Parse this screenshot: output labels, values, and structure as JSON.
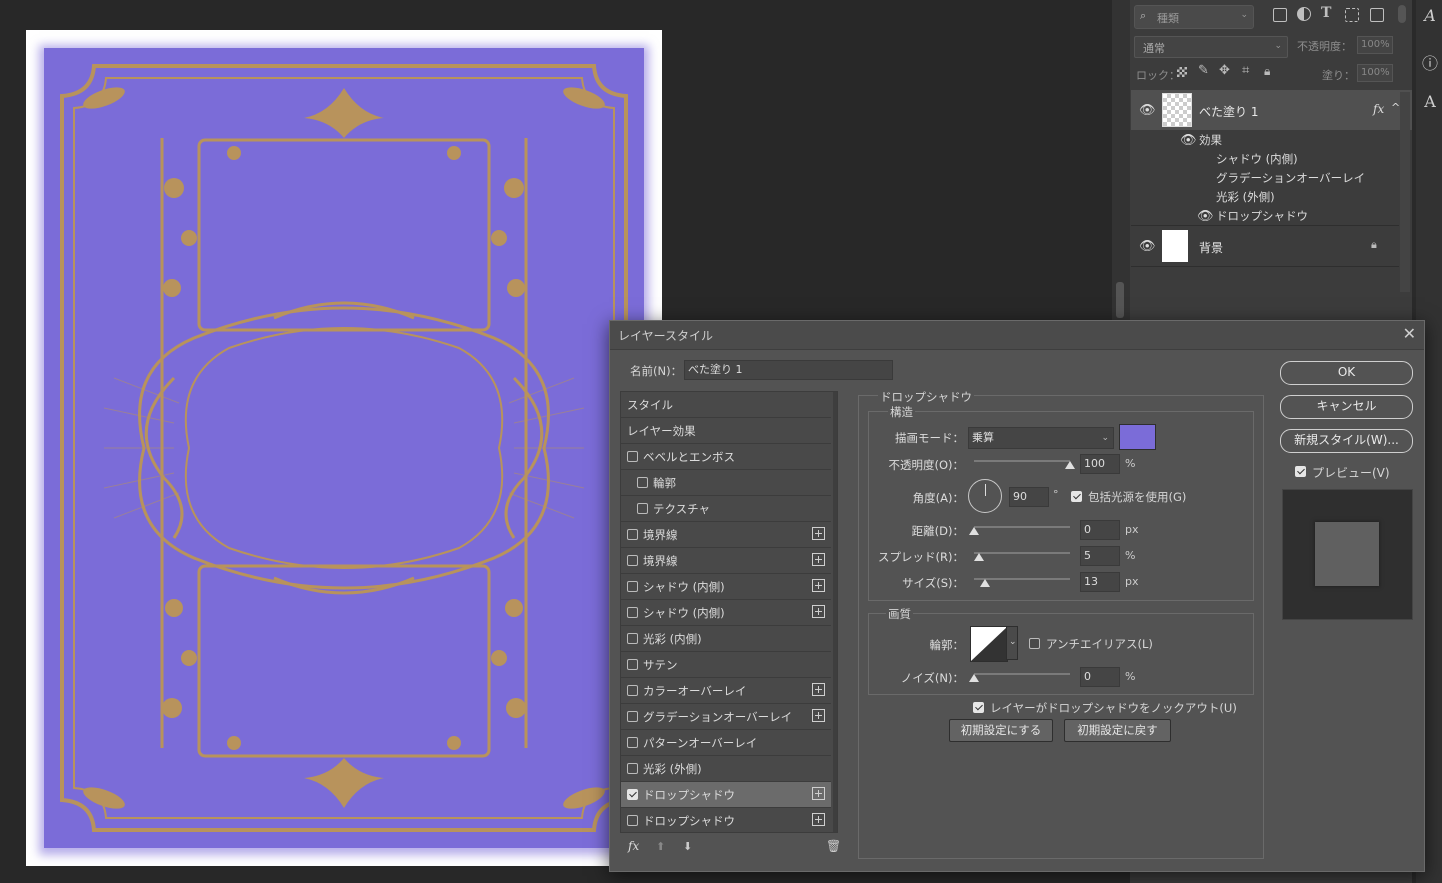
{
  "layers_panel": {
    "filter_placeholder": "種類",
    "blend_mode": "通常",
    "opacity_label": "不透明度：",
    "opacity_value": "100%",
    "lock_label": "ロック：",
    "fill_label": "塗り：",
    "fill_value": "100%",
    "layers": [
      {
        "name": "べた塗り 1",
        "fx_badge": "fx"
      },
      {
        "name": "背景"
      }
    ],
    "effects_label": "効果",
    "effects": [
      "シャドウ (内側)",
      "グラデーションオーバーレイ",
      "光彩 (外側)",
      "ドロップシャドウ"
    ]
  },
  "dialog": {
    "title": "レイヤースタイル",
    "name_label": "名前(N)：",
    "name_value": "べた塗り 1",
    "left_list": [
      {
        "label": "スタイル"
      },
      {
        "label": "レイヤー効果"
      },
      {
        "label": "ベベルとエンボス",
        "checked": false
      },
      {
        "label": "輪郭",
        "checked": false
      },
      {
        "label": "テクスチャ",
        "checked": false
      },
      {
        "label": "境界線",
        "checked": false,
        "plus": true
      },
      {
        "label": "境界線",
        "checked": false,
        "plus": true
      },
      {
        "label": "シャドウ (内側)",
        "checked": false,
        "plus": true
      },
      {
        "label": "シャドウ (内側)",
        "checked": false,
        "plus": true
      },
      {
        "label": "光彩 (内側)",
        "checked": false
      },
      {
        "label": "サテン",
        "checked": false
      },
      {
        "label": "カラーオーバーレイ",
        "checked": false,
        "plus": true
      },
      {
        "label": "グラデーションオーバーレイ",
        "checked": false,
        "plus": true
      },
      {
        "label": "パターンオーバーレイ",
        "checked": false
      },
      {
        "label": "光彩 (外側)",
        "checked": false
      },
      {
        "label": "ドロップシャドウ",
        "checked": true,
        "plus": true,
        "selected": true
      },
      {
        "label": "ドロップシャドウ",
        "checked": false,
        "plus": true
      }
    ],
    "footer_fx": "fx",
    "section_title": "ドロップシャドウ",
    "structure_title": "構造",
    "blend_mode_label": "描画モード：",
    "blend_mode_value": "乗算",
    "shadow_color": "#7b6cd8",
    "opacity_label": "不透明度(O)：",
    "opacity_value": "100",
    "opacity_unit": "%",
    "angle_label": "角度(A)：",
    "angle_value": "90",
    "angle_unit": "°",
    "global_light_label": "包括光源を使用(G)",
    "global_light_checked": true,
    "distance_label": "距離(D)：",
    "distance_value": "0",
    "distance_unit": "px",
    "spread_label": "スプレッド(R)：",
    "spread_value": "5",
    "spread_unit": "%",
    "size_label": "サイズ(S)：",
    "size_value": "13",
    "size_unit": "px",
    "quality_title": "画質",
    "contour_label": "輪郭：",
    "antialias_label": "アンチエイリアス(L)",
    "antialias_checked": false,
    "noise_label": "ノイズ(N)：",
    "noise_value": "0",
    "noise_unit": "%",
    "knockout_label": "レイヤーがドロップシャドウをノックアウト(U)",
    "knockout_checked": true,
    "make_default": "初期設定にする",
    "reset_default": "初期設定に戻す",
    "ok": "OK",
    "cancel": "キャンセル",
    "new_style": "新規スタイル(W)...",
    "preview_label": "プレビュー(V)",
    "preview_checked": true
  },
  "colors": {
    "artwork_fill": "#7b6cd8",
    "ornament": "#b8935c"
  }
}
